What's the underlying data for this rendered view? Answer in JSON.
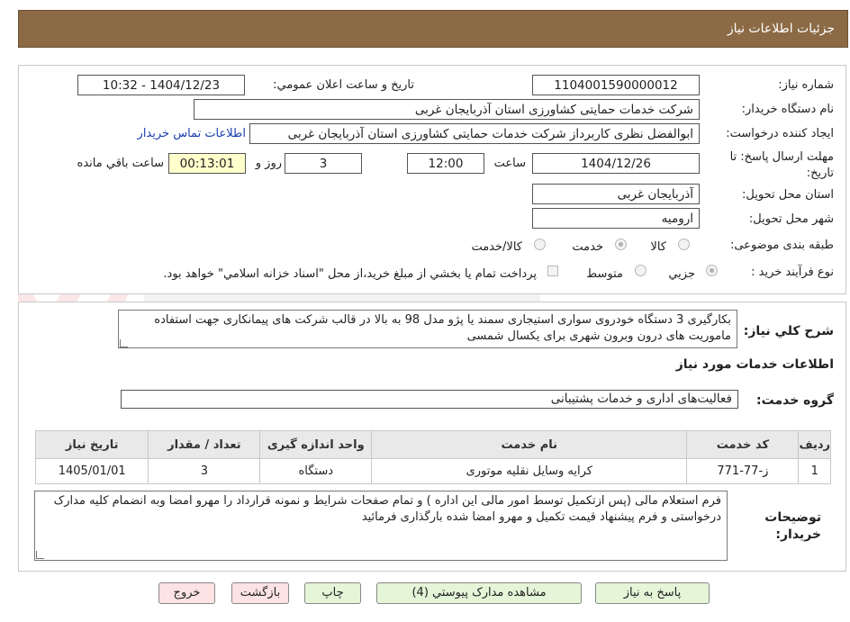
{
  "header": {
    "title": "جزئیات اطلاعات نیاز"
  },
  "form": {
    "need_number_label": "شماره نیاز:",
    "need_number": "1104001590000012",
    "announce_label": "تاریخ و ساعت اعلان عمومي:",
    "announce_value": "1404/12/23 - 10:32",
    "buyer_org_label": "نام دستگاه خريدار:",
    "buyer_org": "شرکت خدمات حمایتی کشاورزی استان آذربایجان غربی",
    "requester_label": "ايجاد کننده درخواست:",
    "requester": "ابوالفضل نظری کاربرداز شرکت خدمات حمایتی کشاورزی استان آذربایجان غربی",
    "contact_link": "اطلاعات تماس خريدار",
    "deadline_label": "مهلت ارسال پاسخ: تا تاريخ:",
    "deadline_date": "1404/12/26",
    "time_label": "ساعت",
    "deadline_time": "12:00",
    "days_value": "3",
    "days_label": "روز و",
    "remaining_value": "00:13:01",
    "remaining_label": "ساعت باقي مانده",
    "province_label": "استان محل تحويل:",
    "province": "آذربایجان غربی",
    "city_label": "شهر محل تحويل:",
    "city": "ارومیه",
    "category_label": "طبقه بندی موضوعی:",
    "category_options": [
      "کالا",
      "خدمت",
      "کالا/خدمت"
    ],
    "category_selected": "خدمت",
    "process_label": "نوع فرآيند خريد :",
    "process_options": [
      "جزيي",
      "متوسط"
    ],
    "payment_note": "پرداخت تمام يا بخشي از مبلغ خريد،از محل \"اسناد خزانه اسلامي\" خواهد بود."
  },
  "description": {
    "label": "شرح کلي نياز:",
    "text": "بکارگیری 3 دستگاه خودروی سواری استیجاری سمند یا پژو مدل 98 به بالا در قالب شرکت های پیمانکاری جهت استفاده ماموریت های درون وبرون شهری برای یکسال شمسی"
  },
  "services": {
    "section_title": "اطلاعات خدمات مورد نياز",
    "group_label": "گروه خدمت:",
    "group_value": "فعالیت‌های اداری و خدمات پشتیبانی",
    "columns": [
      "رديف",
      "کد خدمت",
      "نام خدمت",
      "واحد اندازه گيری",
      "تعداد / مقدار",
      "تاريخ نياز"
    ],
    "rows": [
      {
        "index": "1",
        "code": "ز-77-771",
        "name": "کرایه وسایل نقلیه موتوری",
        "unit": "دستگاه",
        "qty": "3",
        "date": "1405/01/01"
      }
    ]
  },
  "buyer_notes": {
    "label": "توضيحات خريدار:",
    "text": "فرم استعلام مالی (پس ازتکمیل توسط امور مالی این اداره ) و تمام صفحات شرایط و نمونه قرارداد را مهرو امضا وبه انضمام کلیه مدارک درخواستی و فرم پیشنهاد قیمت تکمیل و مهرو امضا شده  بارگذاری فرمائید"
  },
  "buttons": {
    "respond": "پاسخ به نياز",
    "attachments": "مشاهده مدارک پيوستي (4)",
    "print": "چاپ",
    "back": "بازگشت",
    "exit": "خروج"
  },
  "colors": {
    "header_bg": "#8b6a45",
    "link": "#1a3fb0",
    "remaining_bg": "#ffffcc",
    "green_button": "#e5f5d8",
    "pink_button": "#fde3e3"
  }
}
